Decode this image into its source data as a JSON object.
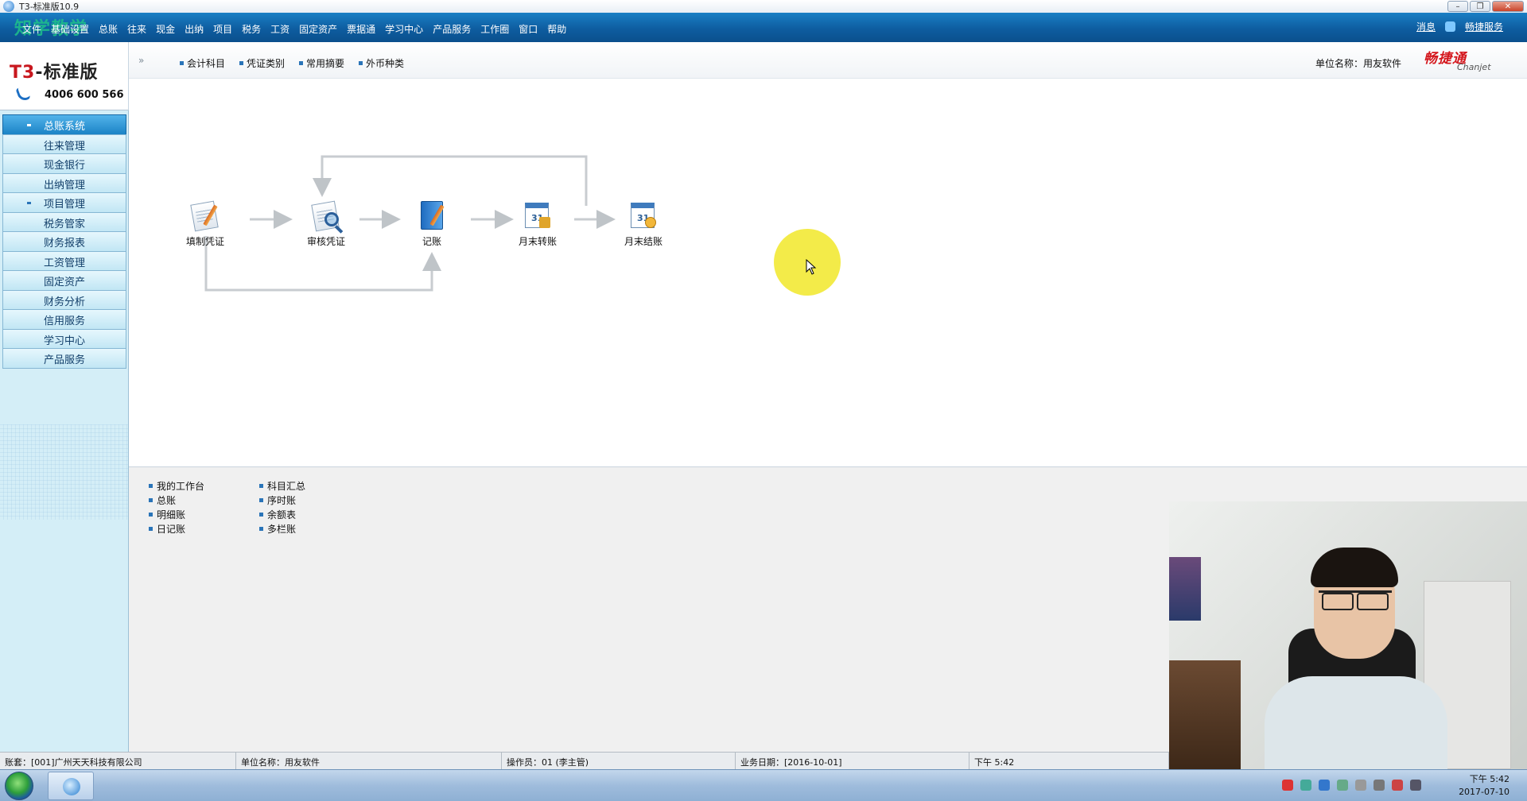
{
  "window": {
    "title": "T3-标准版10.9"
  },
  "menubar": {
    "watermark": "知学教学",
    "items": [
      "文件",
      "基础设置",
      "总账",
      "往来",
      "现金",
      "出纳",
      "项目",
      "税务",
      "工资",
      "固定资产",
      "票据通",
      "学习中心",
      "产品服务",
      "工作圈",
      "窗口",
      "帮助"
    ],
    "right": {
      "message": "消息",
      "service": "畅捷服务"
    }
  },
  "logo": {
    "brand_prefix": "T3",
    "brand_suffix": "-标准版",
    "phone": "4006 600 566"
  },
  "sidebar": {
    "items": [
      {
        "label": "总账系统",
        "active": true
      },
      {
        "label": "往来管理"
      },
      {
        "label": "现金银行"
      },
      {
        "label": "出纳管理"
      },
      {
        "label": "项目管理"
      },
      {
        "label": "税务管家"
      },
      {
        "label": "财务报表"
      },
      {
        "label": "工资管理"
      },
      {
        "label": "固定资产"
      },
      {
        "label": "财务分析"
      },
      {
        "label": "信用服务"
      },
      {
        "label": "学习中心"
      },
      {
        "label": "产品服务"
      }
    ]
  },
  "toolbar": {
    "collapse": "»",
    "links": [
      "会计科目",
      "凭证类别",
      "常用摘要",
      "外币种类"
    ],
    "unit_label": "单位名称：用友软件",
    "chanjet_cn": "畅捷通",
    "chanjet_en": "Chanjet"
  },
  "flow": {
    "nodes": [
      {
        "label": "填制凭证",
        "icon": "fill-voucher-icon"
      },
      {
        "label": "审核凭证",
        "icon": "audit-voucher-icon"
      },
      {
        "label": "记账",
        "icon": "post-ledger-icon"
      },
      {
        "label": "月末转账",
        "icon": "month-end-transfer-icon"
      },
      {
        "label": "月末结账",
        "icon": "month-end-close-icon"
      }
    ]
  },
  "quick_links": {
    "col1": [
      "我的工作台",
      "总账",
      "明细账",
      "日记账"
    ],
    "col2": [
      "科目汇总",
      "序时账",
      "余额表",
      "多栏账"
    ]
  },
  "statusbar": {
    "account": "账套：[001]广州天天科技有限公司",
    "unit": "单位名称：用友软件",
    "operator": "操作员：01 (李主管)",
    "biz_date": "业务日期：[2016-10-01]",
    "time": "下午 5:42"
  },
  "taskbar": {
    "clock_time": "下午 5:42",
    "clock_date": "2017-07-10"
  }
}
